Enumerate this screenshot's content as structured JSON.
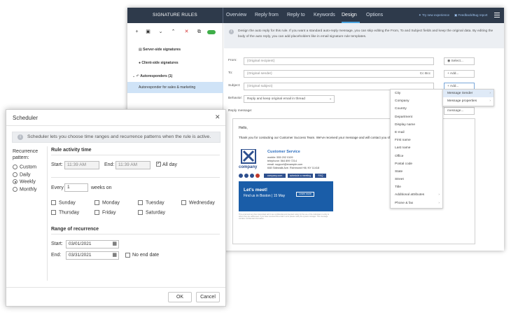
{
  "app": {
    "title": "SIGNATURE RULES",
    "tabs": [
      {
        "label": "Overview"
      },
      {
        "label": "Reply from"
      },
      {
        "label": "Reply to"
      },
      {
        "label": "Keywords"
      },
      {
        "label": "Design"
      },
      {
        "label": "Options"
      }
    ],
    "try_link": "Try new experience",
    "feedback_link": "Feedback/Bug report",
    "sidebar": {
      "server_side": "Server-side signatures",
      "client_side": "Client-side signatures",
      "autoresponders": "Autoresponders (1)",
      "autoresponder_item": "Autoresponder for sales & marketing"
    },
    "info_text": "Design the auto reply for this rule. If you want a standard auto-reply message, you can skip editing the From, To and Subject fields and keep the original data. By editing the body of the auto reply, you can add placeholders like in email signature rule templates.",
    "form": {
      "from_label": "From:",
      "from_value": "{Original recipient}",
      "to_label": "To:",
      "to_value": "{Original sender}",
      "cc_bcc": "Cc  Bcc",
      "subject_label": "Subject:",
      "subject_value": "{Original subject}",
      "behavior_label": "Behavior:",
      "behavior_value": "Reply and keep original email in thread",
      "reply_label": "Reply message:",
      "select_btn": "Select...",
      "add_btn": "Add...",
      "message_btn": "message..."
    },
    "placeholder_menu": [
      "City",
      "Company",
      "Country",
      "Department",
      "Display name",
      "E-mail",
      "First name",
      "Last name",
      "Office",
      "Postal code",
      "State",
      "Street",
      "Title",
      "Additional attributes",
      "Phone & fax"
    ],
    "add_menu": [
      "Message Sender",
      "Message properties"
    ],
    "email": {
      "greeting": "Hello,",
      "body": "Thank you for contacting our Customer Success Team. We've received your message and will contact you shor",
      "sig_title": "Customer Service",
      "sig_mobile": "mobile: 555 202 0109",
      "sig_telephone": "telephone: 564 899 7214",
      "sig_email": "email: support@example.com",
      "sig_address": "648 Sidewalk Ave. Richmond Hill, NY 11418",
      "logo_text": "company",
      "link1": "company.com",
      "link2": "schedule a meeting",
      "link3": "FAQ",
      "banner_title": "Let's meet!",
      "banner_sub": "Find us in Boston | 15 May",
      "banner_btn": "Learn more",
      "disclaimer": "This email and any files transmitted with it are confidential and intended solely for the use of the individual or entity to whom they are addressed. If you have received this email in error please notify the system manager. This message contains confidential information."
    }
  },
  "scheduler": {
    "title": "Scheduler",
    "info": "Scheduler lets you choose time ranges and recurrence patterns when the rule is active.",
    "recurrence_label": "Recurrence pattern:",
    "patterns": [
      "Custom",
      "Daily",
      "Weekly",
      "Monthly"
    ],
    "selected_pattern": "Weekly",
    "activity_heading": "Rule activity time",
    "start_label": "Start:",
    "start_time": "11:39 AM",
    "end_label": "End:",
    "end_time": "11:39 AM",
    "all_day": "All day",
    "every_label": "Every",
    "every_value": "1",
    "weeks_on": "weeks on",
    "days": [
      "Sunday",
      "Monday",
      "Tuesday",
      "Wednesday",
      "Thursday",
      "Friday",
      "Saturday"
    ],
    "range_heading": "Range of recurrence",
    "range_start_label": "Start:",
    "range_start": "03/01/2021",
    "range_end_label": "End:",
    "range_end": "03/31/2021",
    "no_end_date": "No end date",
    "ok": "OK",
    "cancel": "Cancel"
  },
  "colors": {
    "topbar": "#2e3a4b",
    "accent": "#4aa3df",
    "banner": "#1a5da8",
    "logo": "#2d4f8e"
  }
}
